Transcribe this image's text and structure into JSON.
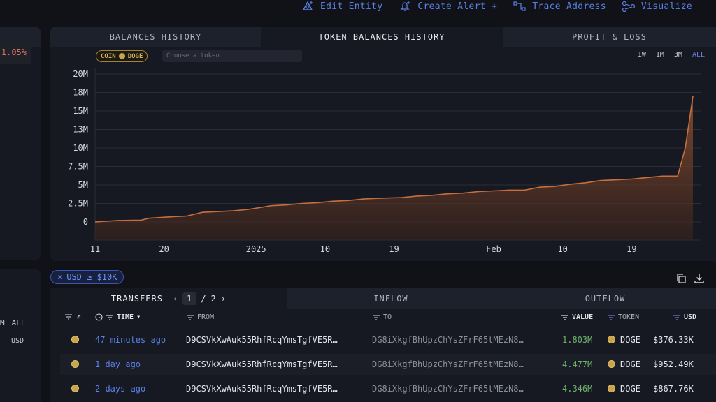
{
  "top_actions": [
    {
      "label": "Edit Entity",
      "icon": "edit-entity-icon"
    },
    {
      "label": "Create Alert +",
      "icon": "bell-icon"
    },
    {
      "label": "Trace Address",
      "icon": "trace-icon"
    },
    {
      "label": "Visualize",
      "icon": "graph-icon"
    }
  ],
  "left_panel": {
    "pct": "1.05%",
    "range_partial": "M",
    "range_all": "ALL",
    "currency": "USD"
  },
  "chart_tabs": [
    "BALANCES HISTORY",
    "TOKEN BALANCES HISTORY",
    "PROFIT & LOSS"
  ],
  "coin_pill": {
    "prefix": "COIN",
    "token": "DOGE"
  },
  "token_input": {
    "placeholder": "Choose a token",
    "value": ""
  },
  "ranges": [
    "1W",
    "1M",
    "3M",
    "ALL"
  ],
  "chart_data": {
    "type": "area",
    "y_tick_labels": [
      "20M",
      "18M",
      "15M",
      "13M",
      "10M",
      "7.5M",
      "5M",
      "2.5M",
      "0"
    ],
    "ylim": [
      0,
      20000000
    ],
    "x_tick_labels": [
      "11",
      "20",
      "2025",
      "10",
      "19",
      "Feb",
      "10",
      "19"
    ],
    "x_tick_dates": [
      "2024-12-11",
      "2024-12-20",
      "2025-01-01",
      "2025-01-10",
      "2025-01-19",
      "2025-02-01",
      "2025-02-10",
      "2025-02-19"
    ],
    "xlim": [
      "2024-12-11",
      "2025-02-28"
    ],
    "grid": true,
    "color": "#c66f3d",
    "series": [
      {
        "x": [
          "2024-12-11",
          "2024-12-14",
          "2024-12-17",
          "2024-12-18",
          "2024-12-21",
          "2024-12-23",
          "2024-12-25",
          "2024-12-29",
          "2024-12-31",
          "2025-01-03",
          "2025-01-05",
          "2025-01-07",
          "2025-01-09",
          "2025-01-11",
          "2025-01-13",
          "2025-01-15",
          "2025-01-17",
          "2025-01-20",
          "2025-01-22",
          "2025-01-24",
          "2025-01-26",
          "2025-01-28",
          "2025-01-30",
          "2025-02-01",
          "2025-02-03",
          "2025-02-05",
          "2025-02-07",
          "2025-02-09",
          "2025-02-11",
          "2025-02-13",
          "2025-02-15",
          "2025-02-17",
          "2025-02-19",
          "2025-02-21",
          "2025-02-23",
          "2025-02-25",
          "2025-02-26",
          "2025-02-27"
        ],
        "values": [
          0,
          200000,
          250000,
          500000,
          700000,
          800000,
          1300000,
          1500000,
          1700000,
          2200000,
          2300000,
          2500000,
          2600000,
          2800000,
          2900000,
          3100000,
          3200000,
          3300000,
          3500000,
          3600000,
          3800000,
          3900000,
          4100000,
          4200000,
          4300000,
          4300000,
          4700000,
          4800000,
          5100000,
          5300000,
          5600000,
          5700000,
          5800000,
          6000000,
          6200000,
          6200000,
          10000000,
          17000000
        ]
      }
    ]
  },
  "filter_pill": {
    "icon": "×",
    "label": "USD ≥ $10K"
  },
  "table_tabs": {
    "transfers": "TRANSFERS",
    "page_current": "1",
    "page_sep": "/",
    "page_total": "2",
    "inflow": "INFLOW",
    "outflow": "OUTFLOW"
  },
  "columns": {
    "time": "TIME",
    "from": "FROM",
    "to": "TO",
    "value": "VALUE",
    "token": "TOKEN",
    "usd": "USD"
  },
  "rows": [
    {
      "time": "47 minutes ago",
      "from": "D9CSVkXwAuk55RhfRcqYmsTgfVE5R…",
      "to": "DG8iXkgfBhUpzChYsZFrF65tMEzN8…",
      "value": "1.803M",
      "token": "DOGE",
      "usd": "$376.33K"
    },
    {
      "time": "1 day ago",
      "from": "D9CSVkXwAuk55RhfRcqYmsTgfVE5R…",
      "to": "DG8iXkgfBhUpzChYsZFrF65tMEzN8…",
      "value": "4.477M",
      "token": "DOGE",
      "usd": "$952.49K"
    },
    {
      "time": "2 days ago",
      "from": "D9CSVkXwAuk55RhfRcqYmsTgfVE5R…",
      "to": "DG8iXkgfBhUpzChYsZFrF65tMEzN8…",
      "value": "4.346M",
      "token": "DOGE",
      "usd": "$867.76K"
    }
  ]
}
